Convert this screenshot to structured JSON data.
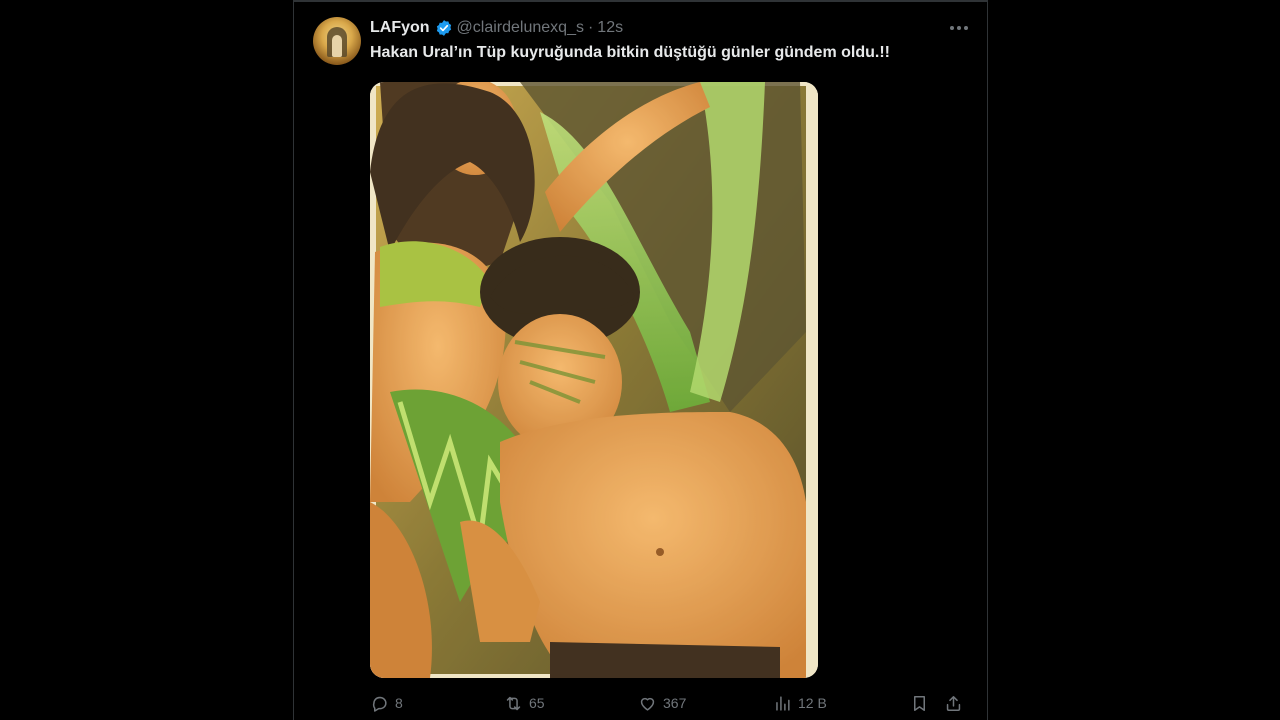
{
  "tweet": {
    "author_name": "LAFyon",
    "verified": true,
    "handle": "@clairdelunexq_s",
    "separator": "·",
    "time": "12s",
    "text": "Hakan Ural’ın  Tüp kuyruğunda bitkin düştüğü günler gündem oldu.!!",
    "media_alt_icon": "photo"
  },
  "actions": {
    "replies": "8",
    "reposts": "65",
    "likes": "367",
    "views": "12 B"
  },
  "colors": {
    "background": "#000000",
    "text_primary": "#e7e9ea",
    "text_secondary": "#71767b",
    "verified_blue": "#1d9bf0",
    "border": "#2f3336"
  }
}
